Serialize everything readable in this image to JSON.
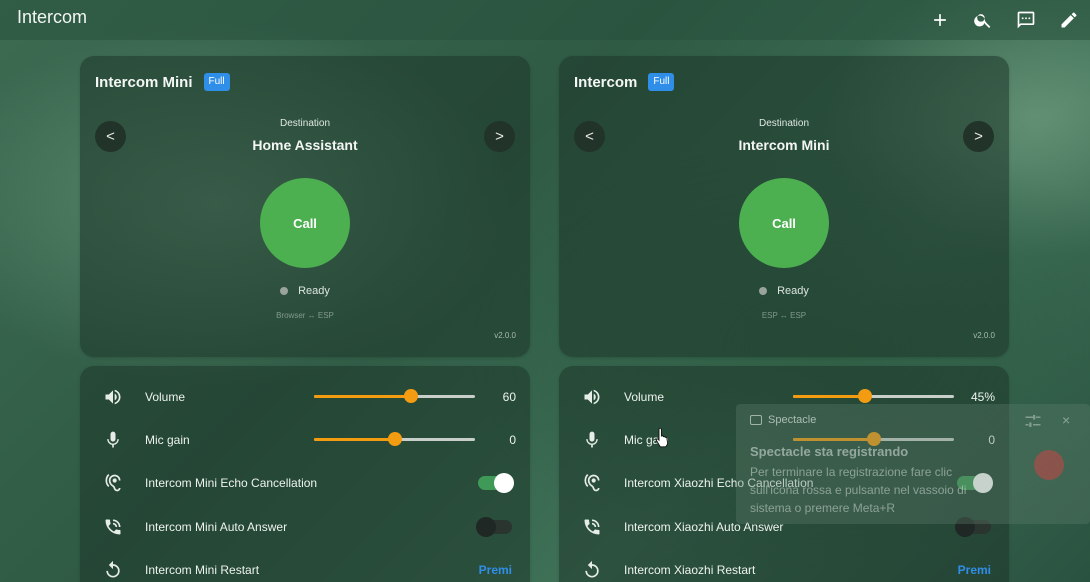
{
  "app": {
    "title": "Intercom"
  },
  "header": {
    "actions": [
      {
        "name": "add-icon"
      },
      {
        "name": "search-icon"
      },
      {
        "name": "chat-icon"
      },
      {
        "name": "edit-icon"
      }
    ]
  },
  "cards": {
    "left": {
      "title": "Intercom Mini",
      "badge": "Full",
      "destination_label": "Destination",
      "destination": "Home Assistant",
      "prev_label": "<",
      "next_label": ">",
      "call_label": "Call",
      "status": "Ready",
      "mode": "Browser ↔ ESP",
      "version": "v2.0.0"
    },
    "right": {
      "title": "Intercom",
      "badge": "Full",
      "destination_label": "Destination",
      "destination": "Intercom Mini",
      "prev_label": "<",
      "next_label": ">",
      "call_label": "Call",
      "status": "Ready",
      "mode": "ESP ↔ ESP",
      "version": "v2.0.0"
    }
  },
  "entities": {
    "left": {
      "volume": {
        "label": "Volume",
        "value": 60,
        "display": "60"
      },
      "mic_gain": {
        "label": "Mic gain",
        "value": 50,
        "display": "0"
      },
      "echo": {
        "label": "Intercom Mini Echo Cancellation",
        "state": "on"
      },
      "auto_answer": {
        "label": "Intercom Mini Auto Answer",
        "state": "off"
      },
      "restart": {
        "label": "Intercom Mini Restart",
        "action": "Premi"
      }
    },
    "right": {
      "volume": {
        "label": "Volume",
        "value": 45,
        "display": "45%"
      },
      "mic_gain": {
        "label": "Mic gain",
        "value": 50,
        "display": "0"
      },
      "echo": {
        "label": "Intercom Xiaozhi Echo Cancellation",
        "state": "on"
      },
      "auto_answer": {
        "label": "Intercom Xiaozhi Auto Answer",
        "state": "off"
      },
      "restart": {
        "label": "Intercom Xiaozhi Restart",
        "action": "Premi"
      }
    }
  },
  "notification": {
    "app_name": "Spectacle",
    "title": "Spectacle sta registrando",
    "body": "Per terminare la registrazione fare clic sull'icona rossa e pulsante nel vassoio di sistema o premere Meta+R",
    "close_label": "×"
  },
  "colors": {
    "accent": "#f39c12",
    "call": "#4caf50",
    "badge": "#2f8fe8",
    "toggle_on": "#3f9a58"
  }
}
